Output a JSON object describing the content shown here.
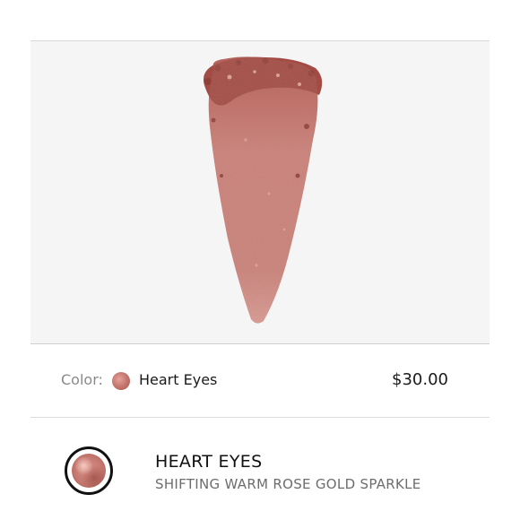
{
  "color_selector": {
    "label": "Color:",
    "name": "Heart Eyes",
    "swatch_color": "#c77a72"
  },
  "price": "$30.00",
  "product": {
    "name": "HEART EYES",
    "description": "SHIFTING WARM ROSE GOLD SPARKLE"
  },
  "colors": {
    "shimmer_base": "#c8786d",
    "shimmer_dark": "#9c4b43",
    "shimmer_light": "#e8aaa1",
    "hero_bg": "#f5f5f5"
  }
}
